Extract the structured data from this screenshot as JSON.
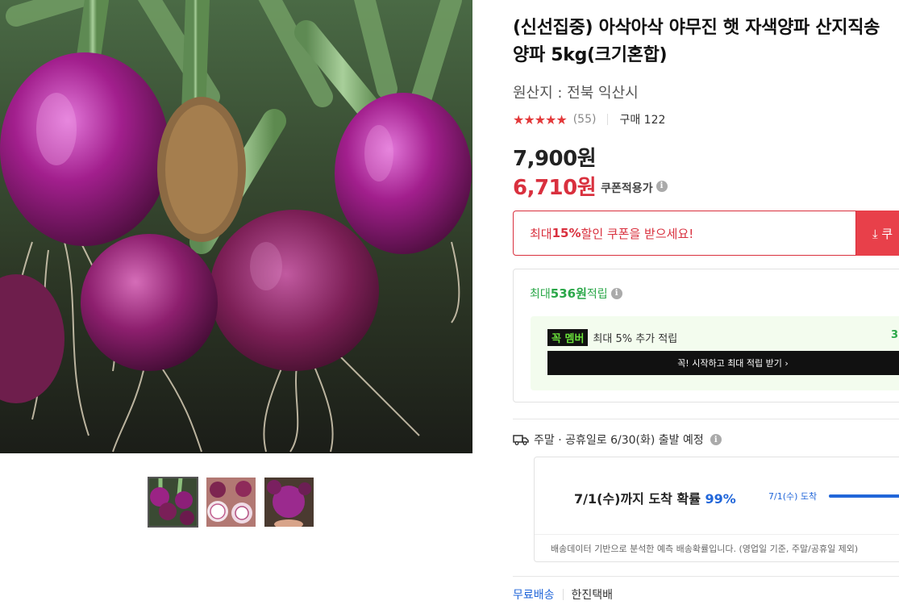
{
  "product": {
    "title": "(신선집중) 아삭아삭 야무진 햇 자색양파 산지직송 양파 5kg(크기혼합)",
    "origin": "원산지 : 전북 익산시",
    "rating_stars": "★★★★★",
    "rating_value": 4.5,
    "rating_count": "(55)",
    "purchase_count": "구매 122",
    "price_original": "7,900원",
    "price_coupon": "6,710원",
    "coupon_price_label": "쿠폰적용가"
  },
  "coupon": {
    "text_prefix": "최대 ",
    "text_pct": "15%",
    "text_suffix": " 할인 쿠폰을 받으세요!",
    "button_label": "⤓ 쿠"
  },
  "points": {
    "prefix": "최대 ",
    "amount": "536원",
    "suffix": " 적립",
    "member_badge": "꼭 멤버",
    "member_text": "최대 5% 추가 적립",
    "member_extra": "3",
    "member_button": "꼭! 시작하고 최대 적립 받기 ›"
  },
  "shipping": {
    "schedule": "주말 · 공휴일로 6/30(화) 출발 예정",
    "arrival_prefix": "7/1(수)까지 도착 확률 ",
    "arrival_pct": "99%",
    "arrival_fraction": 0.99,
    "arrival_side_label": "7/1(수) 도착",
    "note": "배송데이터 기반으로 분석한 예측 배송확률입니다. (영업일 기준, 주말/공휴일 제외)",
    "free_shipping": "무료배송",
    "courier": "한진택배"
  },
  "colors": {
    "accent_red": "#d9303e",
    "points_green": "#2aa748",
    "link_blue": "#2166d9"
  }
}
